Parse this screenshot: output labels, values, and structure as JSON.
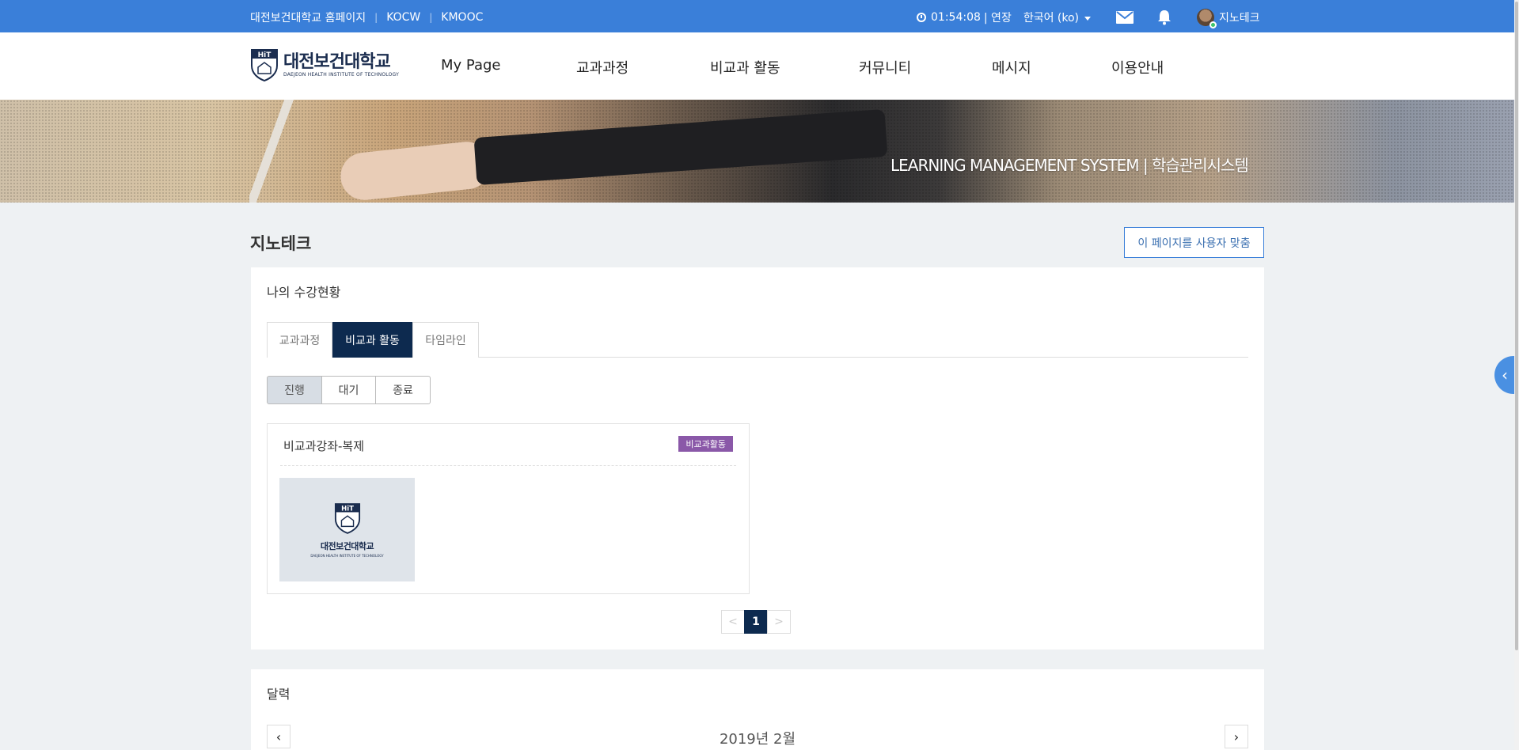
{
  "topbar": {
    "links": [
      "대전보건대학교 홈페이지",
      "KOCW",
      "KMOOC"
    ],
    "separator": "|",
    "session_time": "01:54:08",
    "extend_label": "| 연장",
    "language": "한국어 (ko)",
    "user_name": "지노테크",
    "color": "#3a7fd9"
  },
  "logo": {
    "name_ko": "대전보건대학교",
    "name_en": "DAEJEON HEALTH INSTITUTE OF TECHNOLOGY",
    "emblem_text": "HiT"
  },
  "nav": {
    "items": [
      "My Page",
      "교과과정",
      "비교과 활동",
      "커뮤니티",
      "메시지",
      "이용안내"
    ]
  },
  "banner": {
    "title": "LEARNING MANAGEMENT SYSTEM | 학습관리시스템"
  },
  "page": {
    "title": "지노테크",
    "customize_button": "이 페이지를 사용자 맞춤"
  },
  "enrollment": {
    "title": "나의 수강현황",
    "tabs": [
      "교과과정",
      "비교과 활동",
      "타임라인"
    ],
    "active_tab": "비교과 활동",
    "filters": [
      "진행",
      "대기",
      "종료"
    ],
    "active_filter": "진행",
    "courses": [
      {
        "name": "비교과강좌-복제",
        "badge": "비교과활동",
        "badge_color": "#8a58a8"
      }
    ],
    "pager": {
      "prev": "<",
      "current": "1",
      "next": ">"
    }
  },
  "calendar": {
    "title": "달력",
    "month": "2019년 2월",
    "prev": "‹",
    "next": "›"
  },
  "side_toggle": {
    "glyph": "‹"
  }
}
